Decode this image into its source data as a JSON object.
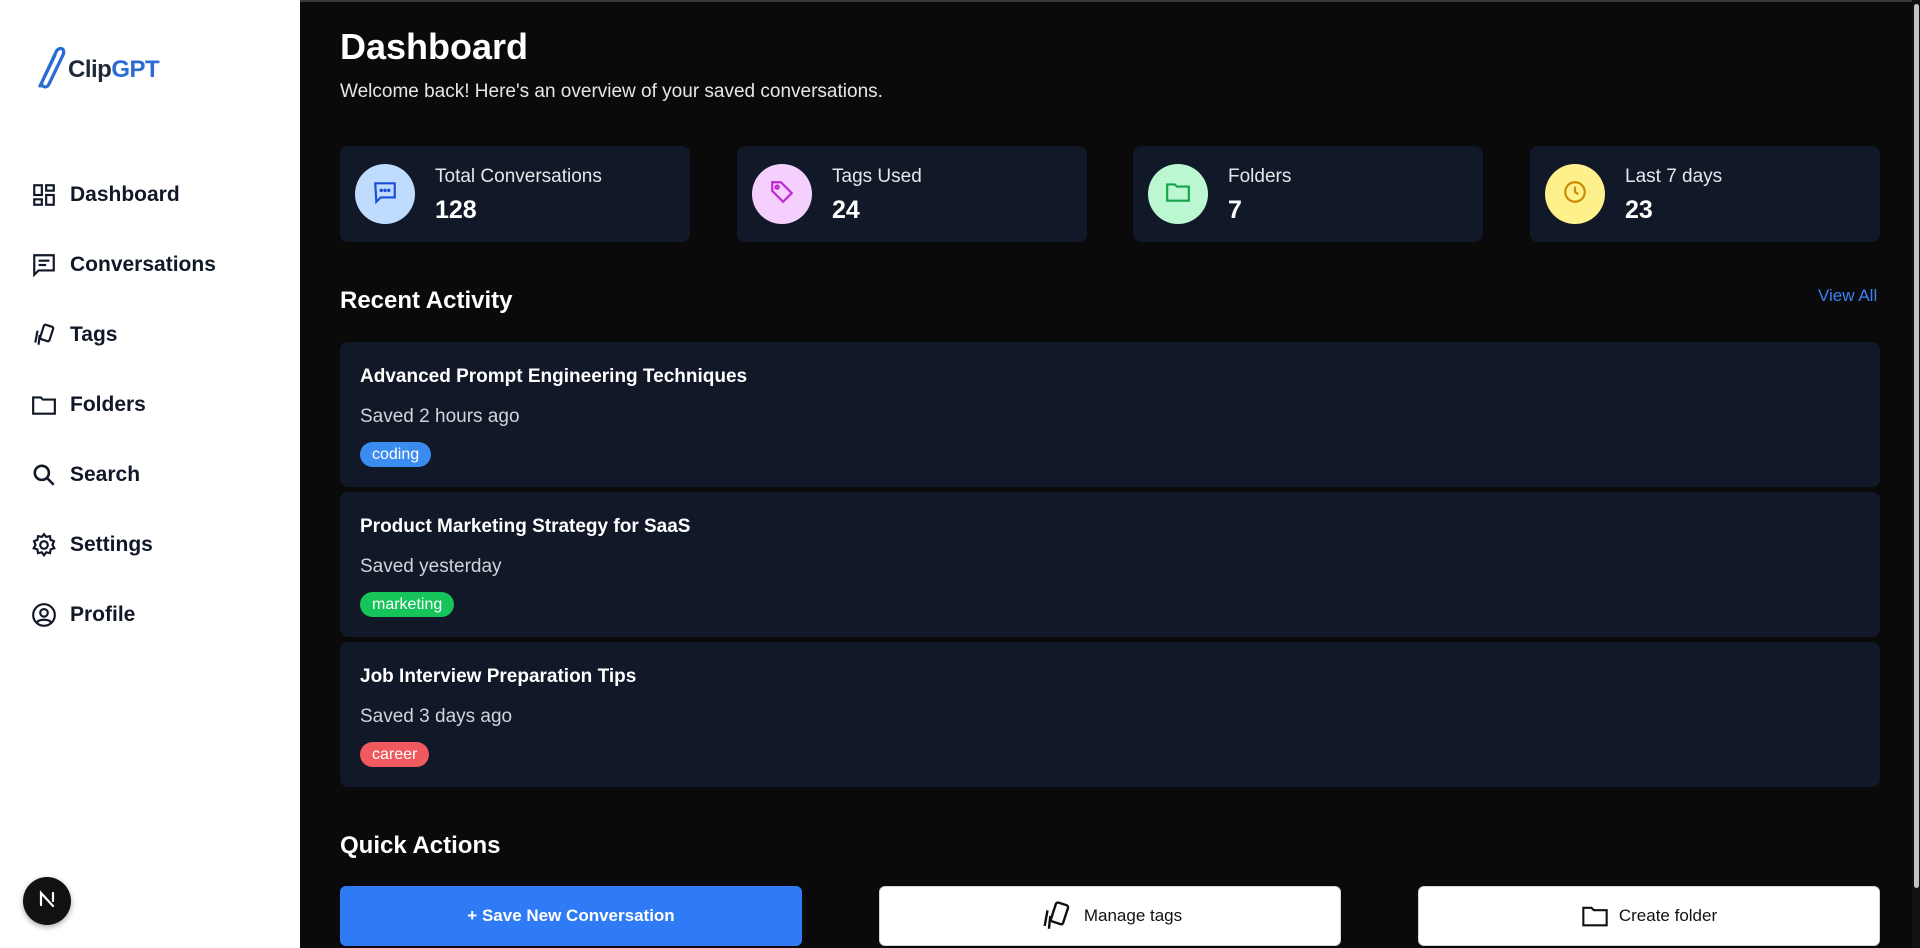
{
  "brand": {
    "clip": "Clip",
    "gpt": "GPT",
    "accent": "#2b6cd4"
  },
  "sidebar": {
    "items": [
      {
        "label": "Dashboard",
        "icon": "dashboard-icon"
      },
      {
        "label": "Conversations",
        "icon": "chat-icon"
      },
      {
        "label": "Tags",
        "icon": "tags-icon"
      },
      {
        "label": "Folders",
        "icon": "folder-icon"
      },
      {
        "label": "Search",
        "icon": "search-icon"
      },
      {
        "label": "Settings",
        "icon": "gear-icon"
      },
      {
        "label": "Profile",
        "icon": "user-circle-icon"
      }
    ],
    "badge": "N"
  },
  "header": {
    "title": "Dashboard",
    "subtitle": "Welcome back! Here's an overview of your saved conversations."
  },
  "stats": [
    {
      "label": "Total Conversations",
      "value": "128",
      "icon": "chat-icon",
      "bg": "#bfdbfe",
      "fg": "#1d4ed8"
    },
    {
      "label": "Tags Used",
      "value": "24",
      "icon": "tag-icon",
      "bg": "#f5d0fe",
      "fg": "#c026d3"
    },
    {
      "label": "Folders",
      "value": "7",
      "icon": "folder-icon",
      "bg": "#bbf7d0",
      "fg": "#16a34a"
    },
    {
      "label": "Last 7 days",
      "value": "23",
      "icon": "clock-icon",
      "bg": "#fef08a",
      "fg": "#ca8a04"
    }
  ],
  "recent": {
    "title": "Recent Activity",
    "view_all": "View All",
    "items": [
      {
        "title": "Advanced Prompt Engineering Techniques",
        "time": "Saved 2 hours ago",
        "tag": "coding",
        "tag_color": "#3b8cf0"
      },
      {
        "title": "Product Marketing Strategy for SaaS",
        "time": "Saved yesterday",
        "tag": "marketing",
        "tag_color": "#16c45a"
      },
      {
        "title": "Job Interview Preparation Tips",
        "time": "Saved 3 days ago",
        "tag": "career",
        "tag_color": "#f0595d"
      }
    ]
  },
  "quick_actions": {
    "title": "Quick Actions",
    "save_new": "+ Save New Conversation",
    "manage_tags": "Manage tags",
    "create_folder": "Create folder"
  }
}
